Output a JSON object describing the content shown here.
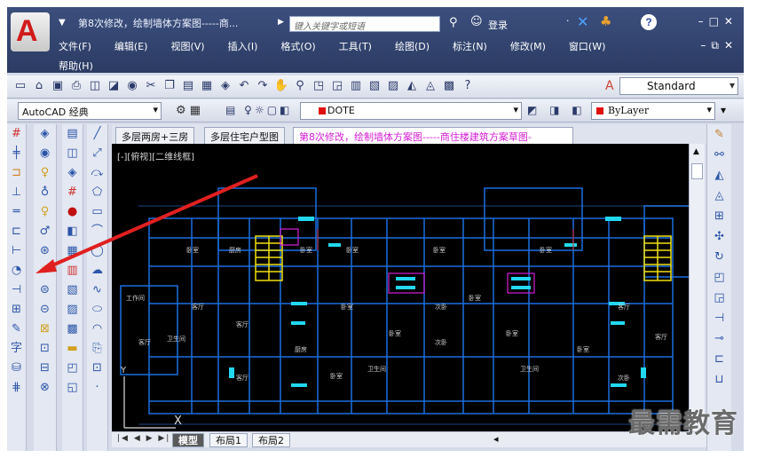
{
  "app": {
    "logo_letter": "A",
    "doc_title": "第8次修改，绘制墙体方案图-----商...",
    "search_placeholder": "键入关键字或短语",
    "login": "登录",
    "help": "?"
  },
  "menu": {
    "items": [
      "文件(F)",
      "编辑(E)",
      "视图(V)",
      "插入(I)",
      "格式(O)",
      "工具(T)",
      "绘图(D)",
      "标注(N)",
      "修改(M)",
      "窗口(W)"
    ],
    "help": "帮助(H)"
  },
  "toolbar": {
    "text_style": "Standard"
  },
  "layer_toolbar": {
    "workspace": "AutoCAD 经典",
    "layer_name": "DOTE",
    "color": "ByLayer",
    "layer_color": "#e01010"
  },
  "file_tabs": [
    {
      "label": "多层两房+三房",
      "active": false
    },
    {
      "label": "多层住宅户型图",
      "active": false
    },
    {
      "label": "第8次修改，绘制墙体方案图-----商住楼建筑方案草图-",
      "active": true
    }
  ],
  "drawing": {
    "viewport_label": "[-][俯视][二维线框]",
    "ucs_x": "X",
    "ucs_y": "Y",
    "room_labels": [
      "卧室",
      "厨房",
      "卧室",
      "卧室",
      "工作间",
      "卧室",
      "客厅",
      "客厅",
      "厨房",
      "卧室",
      "卧室",
      "客厅",
      "卧室",
      "卧室",
      "卧室",
      "客厅",
      "卧室",
      "次卧",
      "次卧",
      "卧室",
      "卫生间",
      "卫生间",
      "客厅",
      "客厅",
      "次卧",
      "卫生间"
    ]
  },
  "layout_tabs": [
    {
      "label": "模型",
      "active": true
    },
    {
      "label": "布局1",
      "active": false
    },
    {
      "label": "布局2",
      "active": false
    }
  ],
  "colors": {
    "wall": "#1a6fe0",
    "fixture": "#22d8f0",
    "stair": "#f0e010",
    "arrow": "#e02020",
    "highlight": "#d41ed4"
  },
  "watermark": "最需教育"
}
